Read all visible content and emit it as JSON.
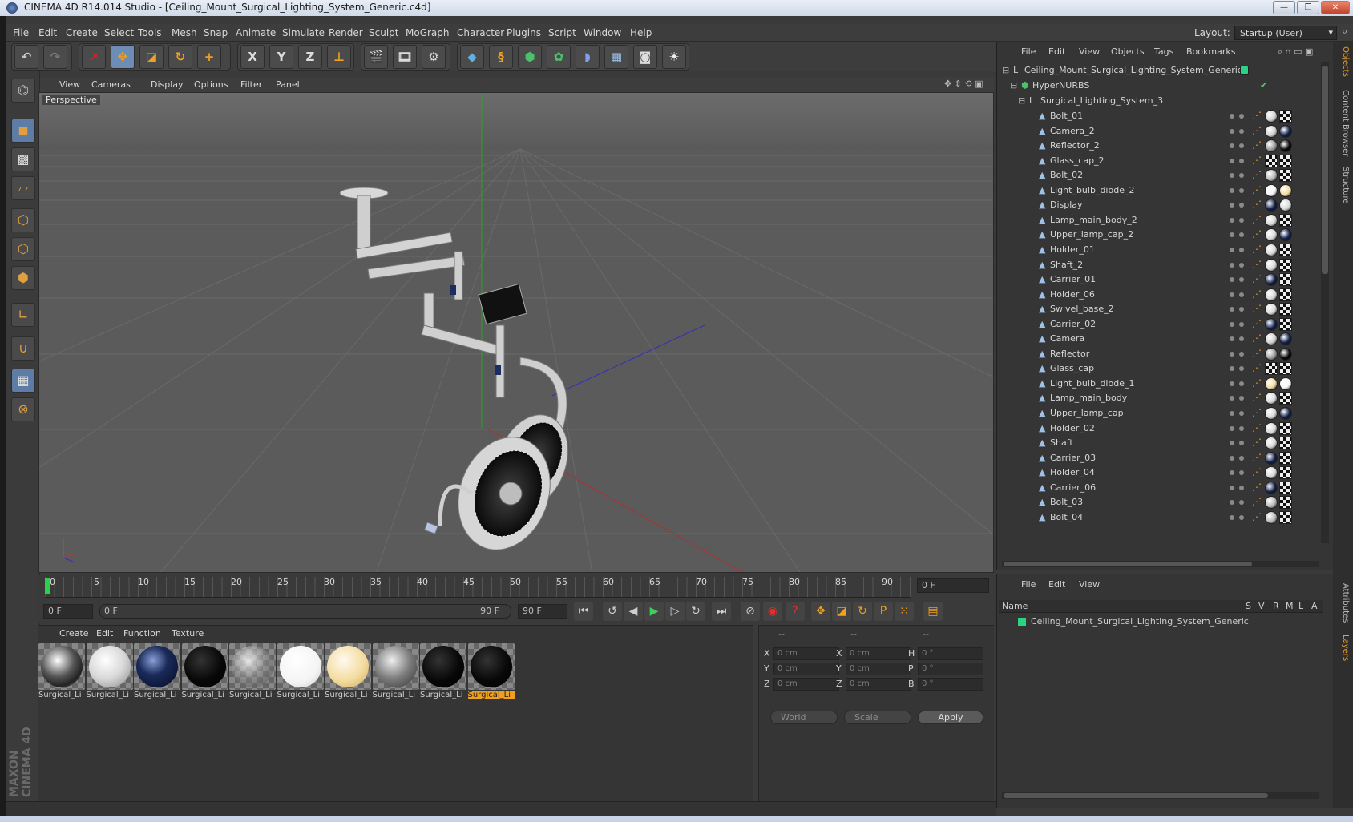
{
  "window": {
    "title": "CINEMA 4D R14.014 Studio - [Ceiling_Mount_Surgical_Lighting_System_Generic.c4d]",
    "btn_min": "—",
    "btn_max": "❐",
    "btn_close": "✕"
  },
  "menubar": {
    "items": [
      "File",
      "Edit",
      "Create",
      "Select",
      "Tools",
      "Mesh",
      "Snap",
      "Animate",
      "Simulate",
      "Render",
      "Sculpt",
      "MoGraph",
      "Character",
      "Plugins",
      "Script",
      "Window",
      "Help"
    ],
    "layout_label": "Layout:",
    "layout_value": "Startup (User)"
  },
  "toolbar": {
    "undo": "↶",
    "redo": "↷",
    "axis_x": "X",
    "axis_y": "Y",
    "axis_z": "Z"
  },
  "viewport": {
    "menu": [
      "View",
      "Cameras",
      "Display",
      "Options",
      "Filter",
      "Panel"
    ],
    "label": "Perspective"
  },
  "timeline": {
    "ticks": [
      "0",
      "5",
      "10",
      "15",
      "20",
      "25",
      "30",
      "35",
      "40",
      "45",
      "50",
      "55",
      "60",
      "65",
      "70",
      "75",
      "80",
      "85",
      "90"
    ],
    "current_frame": "0 F",
    "start_field": "0 F",
    "range_start": "0 F",
    "range_end": "90 F",
    "end_field": "90 F"
  },
  "materials": {
    "menu": [
      "Create",
      "Edit",
      "Function",
      "Texture"
    ],
    "items": [
      {
        "label": "Surgical_Li",
        "color": "#9a9a9a",
        "style": "chrome"
      },
      {
        "label": "Surgical_Li",
        "color": "#e8e8e8",
        "style": "white"
      },
      {
        "label": "Surgical_Li",
        "color": "#1a2a5a",
        "style": "navy"
      },
      {
        "label": "Surgical_Li",
        "color": "#111111",
        "style": "black"
      },
      {
        "label": "Surgical_Li",
        "color": "#8a8a8a",
        "style": "glass"
      },
      {
        "label": "Surgical_Li",
        "color": "#f4f4f4",
        "style": "bright"
      },
      {
        "label": "Surgical_Li",
        "color": "#f4dca0",
        "style": "cream"
      },
      {
        "label": "Surgical_Li",
        "color": "#7c7c7c",
        "style": "grey"
      },
      {
        "label": "Surgical_Li",
        "color": "#0c0c0c",
        "style": "black"
      },
      {
        "label": "Surgical_Li",
        "color": "#0a0a0a",
        "style": "black",
        "selected": true
      }
    ]
  },
  "coordinates": {
    "headers": [
      "--",
      "--",
      "--"
    ],
    "rows": [
      {
        "a": "X",
        "av": "0 cm",
        "b": "X",
        "bv": "0 cm",
        "c": "H",
        "cv": "0 °"
      },
      {
        "a": "Y",
        "av": "0 cm",
        "b": "Y",
        "bv": "0 cm",
        "c": "P",
        "cv": "0 °"
      },
      {
        "a": "Z",
        "av": "0 cm",
        "b": "Z",
        "bv": "0 cm",
        "c": "B",
        "cv": "0 °"
      }
    ],
    "mode1": "World",
    "mode2": "Scale",
    "apply": "Apply"
  },
  "objects": {
    "menu": [
      "File",
      "Edit",
      "View",
      "Objects",
      "Tags",
      "Bookmarks"
    ],
    "root": "Ceiling_Mount_Surgical_Lighting_System_Generic",
    "nurbs": "HyperNURBS",
    "group": "Surgical_Lighting_System_3",
    "children": [
      {
        "name": "Bolt_01",
        "t1": "#cfcfcf",
        "t2": "check"
      },
      {
        "name": "Camera_2",
        "t1": "#d0d0d0",
        "t2": "#0f1e48"
      },
      {
        "name": "Reflector_2",
        "t1": "#9a9a9a",
        "t2": "#050505"
      },
      {
        "name": "Glass_cap_2",
        "t1": "check",
        "t2": "check"
      },
      {
        "name": "Bolt_02",
        "t1": "#b8b8b8",
        "t2": "check"
      },
      {
        "name": "Light_bulb_diode_2",
        "t1": "#f6f6f6",
        "t2": "#f4dca0"
      },
      {
        "name": "Display",
        "t1": "#0f1e48",
        "t2": "#d8d8d8"
      },
      {
        "name": "Lamp_main_body_2",
        "t1": "#d8d8d8",
        "t2": "check"
      },
      {
        "name": "Upper_lamp_cap_2",
        "t1": "#d8d8d8",
        "t2": "#0f1e48"
      },
      {
        "name": "Holder_01",
        "t1": "#d8d8d8",
        "t2": "check"
      },
      {
        "name": "Shaft_2",
        "t1": "#d8d8d8",
        "t2": "check"
      },
      {
        "name": "Carrier_01",
        "t1": "#0f1e48",
        "t2": "check"
      },
      {
        "name": "Holder_06",
        "t1": "#d8d8d8",
        "t2": "check"
      },
      {
        "name": "Swivel_base_2",
        "t1": "#d8d8d8",
        "t2": "check"
      },
      {
        "name": "Carrier_02",
        "t1": "#0f1e48",
        "t2": "check"
      },
      {
        "name": "Camera",
        "t1": "#d0d0d0",
        "t2": "#0f1e48"
      },
      {
        "name": "Reflector",
        "t1": "#9a9a9a",
        "t2": "#050505"
      },
      {
        "name": "Glass_cap",
        "t1": "check",
        "t2": "check"
      },
      {
        "name": "Light_bulb_diode_1",
        "t1": "#f4dca0",
        "t2": "#f6f6f6"
      },
      {
        "name": "Lamp_main_body",
        "t1": "#d8d8d8",
        "t2": "check"
      },
      {
        "name": "Upper_lamp_cap",
        "t1": "#d8d8d8",
        "t2": "#0f1e48"
      },
      {
        "name": "Holder_02",
        "t1": "#d8d8d8",
        "t2": "check"
      },
      {
        "name": "Shaft",
        "t1": "#d8d8d8",
        "t2": "check"
      },
      {
        "name": "Carrier_03",
        "t1": "#0f1e48",
        "t2": "check"
      },
      {
        "name": "Holder_04",
        "t1": "#d8d8d8",
        "t2": "check"
      },
      {
        "name": "Carrier_06",
        "t1": "#0f1e48",
        "t2": "check"
      },
      {
        "name": "Bolt_03",
        "t1": "#b8b8b8",
        "t2": "check"
      },
      {
        "name": "Bolt_04",
        "t1": "#b8b8b8",
        "t2": "check"
      }
    ]
  },
  "layers": {
    "menu": [
      "File",
      "Edit",
      "View"
    ],
    "col_name": "Name",
    "cols": [
      "S",
      "V",
      "R",
      "M",
      "L",
      "A"
    ],
    "row": "Ceiling_Mount_Surgical_Lighting_System_Generic"
  },
  "right_tabs": [
    "Objects",
    "Content Browser",
    "Structure",
    "Attributes",
    "Layers"
  ],
  "brand": "MAXON CINEMA 4D",
  "accent": "#f0a020"
}
